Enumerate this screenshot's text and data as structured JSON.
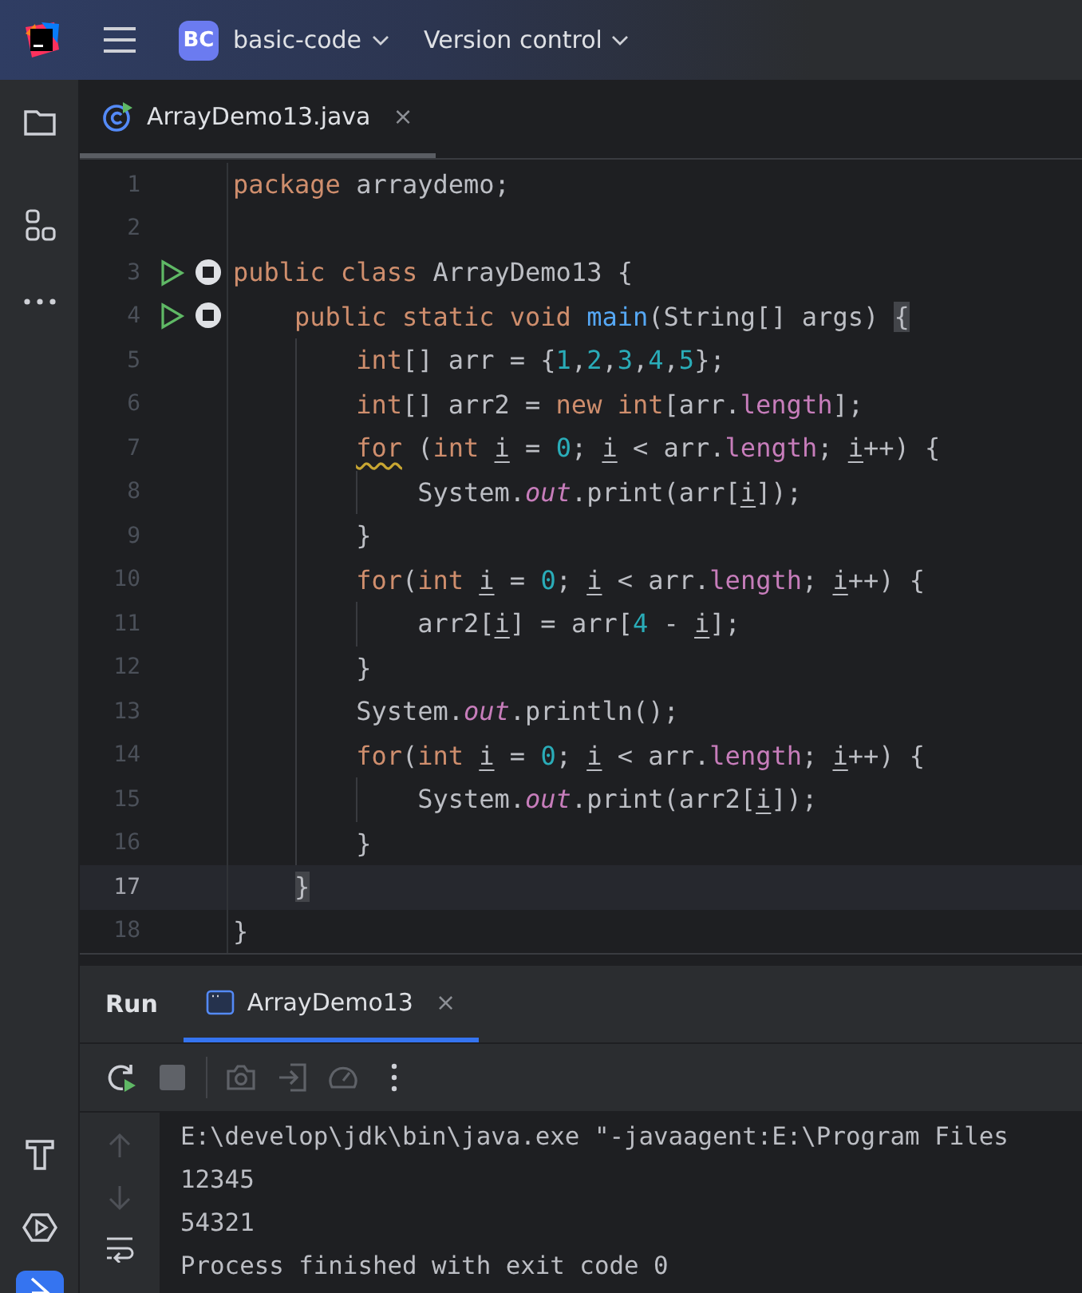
{
  "title_bar": {
    "project_badge": "BC",
    "project": "basic-code",
    "vcs": "Version control"
  },
  "editor_tabs": [
    {
      "label": "ArrayDemo13.java",
      "close": "×",
      "selected": true
    }
  ],
  "code": {
    "lines": [
      {
        "number": "1",
        "run_marker": false,
        "current": false,
        "tokens": [
          {
            "kind": "keyword",
            "text": "package "
          },
          {
            "kind": "text",
            "text": "arraydemo;"
          }
        ]
      },
      {
        "number": "2",
        "run_marker": false,
        "current": false
      },
      {
        "number": "3",
        "run_marker": true,
        "current": false,
        "tokens": [
          {
            "kind": "keyword",
            "text": "public class "
          },
          {
            "kind": "text",
            "text": "ArrayDemo13 {"
          }
        ]
      },
      {
        "number": "4",
        "run_marker": true,
        "current": false,
        "tokens": [
          {
            "kind": "keyword",
            "text": "    public static void "
          },
          {
            "kind": "method",
            "text": "main"
          },
          {
            "kind": "text",
            "text": "(String[] args) "
          },
          {
            "kind": "brace",
            "text": "{"
          }
        ]
      },
      {
        "number": "5",
        "run_marker": false,
        "current": false,
        "tokens": [
          {
            "kind": "keyword",
            "text": "        int"
          },
          {
            "kind": "text",
            "text": "[] arr = {"
          },
          {
            "kind": "number",
            "text": "1"
          },
          {
            "kind": "text",
            "text": ","
          },
          {
            "kind": "number",
            "text": "2"
          },
          {
            "kind": "text",
            "text": ","
          },
          {
            "kind": "number",
            "text": "3"
          },
          {
            "kind": "text",
            "text": ","
          },
          {
            "kind": "number",
            "text": "4"
          },
          {
            "kind": "text",
            "text": ","
          },
          {
            "kind": "number",
            "text": "5"
          },
          {
            "kind": "text",
            "text": "};"
          }
        ]
      },
      {
        "number": "6",
        "run_marker": false,
        "current": false,
        "tokens": [
          {
            "kind": "keyword",
            "text": "        int"
          },
          {
            "kind": "text",
            "text": "[] arr2 = "
          },
          {
            "kind": "keyword",
            "text": "new int"
          },
          {
            "kind": "text",
            "text": "[arr."
          },
          {
            "kind": "field",
            "text": "length"
          },
          {
            "kind": "text",
            "text": "];"
          }
        ]
      },
      {
        "number": "7",
        "run_marker": false,
        "current": false,
        "tokens": [
          {
            "kind": "warning",
            "text": "        for"
          },
          {
            "kind": "text",
            "text": " ("
          },
          {
            "kind": "keyword",
            "text": "int "
          },
          {
            "kind": "var",
            "text": "i"
          },
          {
            "kind": "text",
            "text": " = "
          },
          {
            "kind": "number",
            "text": "0"
          },
          {
            "kind": "text",
            "text": "; "
          },
          {
            "kind": "var",
            "text": "i"
          },
          {
            "kind": "text",
            "text": " < arr."
          },
          {
            "kind": "field",
            "text": "length"
          },
          {
            "kind": "text",
            "text": "; "
          },
          {
            "kind": "var",
            "text": "i"
          },
          {
            "kind": "text",
            "text": "++) {"
          }
        ]
      },
      {
        "number": "8",
        "run_marker": false,
        "current": false,
        "tokens": [
          {
            "kind": "text",
            "text": "            System."
          },
          {
            "kind": "static",
            "text": "out"
          },
          {
            "kind": "text",
            "text": ".print(arr["
          },
          {
            "kind": "var",
            "text": "i"
          },
          {
            "kind": "text",
            "text": "]);"
          }
        ]
      },
      {
        "number": "9",
        "run_marker": false,
        "current": false,
        "tokens": [
          {
            "kind": "text",
            "text": "        }"
          }
        ]
      },
      {
        "number": "10",
        "run_marker": false,
        "current": false,
        "tokens": [
          {
            "kind": "keyword",
            "text": "        for"
          },
          {
            "kind": "text",
            "text": "("
          },
          {
            "kind": "keyword",
            "text": "int "
          },
          {
            "kind": "var",
            "text": "i"
          },
          {
            "kind": "text",
            "text": " = "
          },
          {
            "kind": "number",
            "text": "0"
          },
          {
            "kind": "text",
            "text": "; "
          },
          {
            "kind": "var",
            "text": "i"
          },
          {
            "kind": "text",
            "text": " < arr."
          },
          {
            "kind": "field",
            "text": "length"
          },
          {
            "kind": "text",
            "text": "; "
          },
          {
            "kind": "var",
            "text": "i"
          },
          {
            "kind": "text",
            "text": "++) {"
          }
        ]
      },
      {
        "number": "11",
        "run_marker": false,
        "current": false,
        "tokens": [
          {
            "kind": "text",
            "text": "            arr2["
          },
          {
            "kind": "var",
            "text": "i"
          },
          {
            "kind": "text",
            "text": "] = arr["
          },
          {
            "kind": "number",
            "text": "4"
          },
          {
            "kind": "text",
            "text": " - "
          },
          {
            "kind": "var",
            "text": "i"
          },
          {
            "kind": "text",
            "text": "];"
          }
        ]
      },
      {
        "number": "12",
        "run_marker": false,
        "current": false,
        "tokens": [
          {
            "kind": "text",
            "text": "        }"
          }
        ]
      },
      {
        "number": "13",
        "run_marker": false,
        "current": false,
        "tokens": [
          {
            "kind": "text",
            "text": "        System."
          },
          {
            "kind": "static",
            "text": "out"
          },
          {
            "kind": "text",
            "text": ".println();"
          }
        ]
      },
      {
        "number": "14",
        "run_marker": false,
        "current": false,
        "tokens": [
          {
            "kind": "keyword",
            "text": "        for"
          },
          {
            "kind": "text",
            "text": "("
          },
          {
            "kind": "keyword",
            "text": "int "
          },
          {
            "kind": "var",
            "text": "i"
          },
          {
            "kind": "text",
            "text": " = "
          },
          {
            "kind": "number",
            "text": "0"
          },
          {
            "kind": "text",
            "text": "; "
          },
          {
            "kind": "var",
            "text": "i"
          },
          {
            "kind": "text",
            "text": " < arr."
          },
          {
            "kind": "field",
            "text": "length"
          },
          {
            "kind": "text",
            "text": "; "
          },
          {
            "kind": "var",
            "text": "i"
          },
          {
            "kind": "text",
            "text": "++) {"
          }
        ]
      },
      {
        "number": "15",
        "run_marker": false,
        "current": false,
        "tokens": [
          {
            "kind": "text",
            "text": "            System."
          },
          {
            "kind": "static",
            "text": "out"
          },
          {
            "kind": "text",
            "text": ".print(arr2["
          },
          {
            "kind": "var",
            "text": "i"
          },
          {
            "kind": "text",
            "text": "]);"
          }
        ]
      },
      {
        "number": "16",
        "run_marker": false,
        "current": false,
        "tokens": [
          {
            "kind": "text",
            "text": "        }"
          }
        ]
      },
      {
        "number": "17",
        "run_marker": false,
        "current": true,
        "tokens": [
          {
            "kind": "brace",
            "text": "    }"
          }
        ]
      },
      {
        "number": "18",
        "run_marker": false,
        "current": false,
        "tokens": [
          {
            "kind": "text",
            "text": "}"
          }
        ]
      }
    ]
  },
  "run_panel": {
    "title": "Run",
    "tabs": [
      {
        "label": "ArrayDemo13",
        "close": "×",
        "selected": true
      }
    ],
    "toolbar": [
      {
        "kind": "rerun",
        "disabled": false
      },
      {
        "kind": "stop",
        "disabled": true
      },
      {
        "kind": "separator"
      },
      {
        "kind": "camera",
        "disabled": true
      },
      {
        "kind": "exit",
        "disabled": true
      },
      {
        "kind": "gauge",
        "disabled": true
      },
      {
        "kind": "more",
        "disabled": false
      }
    ],
    "console_nav": [
      {
        "kind": "up",
        "disabled": true
      },
      {
        "kind": "down",
        "disabled": true
      },
      {
        "kind": "wrap",
        "disabled": false
      }
    ],
    "console": [
      "E:\\develop\\jdk\\bin\\java.exe \"-javaagent:E:\\Program Files",
      "12345",
      "54321",
      "Process finished with exit code 0"
    ]
  }
}
